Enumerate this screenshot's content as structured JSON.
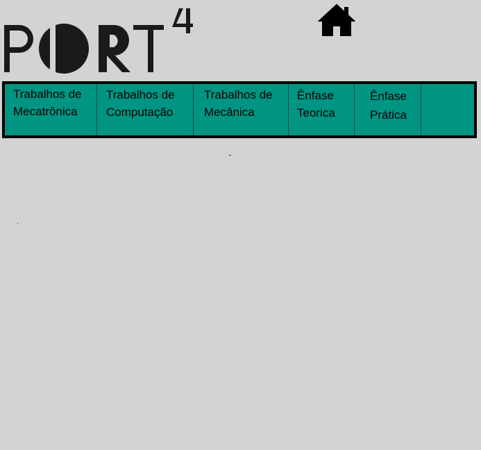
{
  "header": {
    "logo_text": "PORT",
    "logo_superscript": "4",
    "home_icon": "home-icon"
  },
  "nav": {
    "items": [
      {
        "line1": "Trabalhos de",
        "line2": "Mecatrônica"
      },
      {
        "line1": "Trabalhos de",
        "line2": "Computação"
      },
      {
        "line1": "Trabalhos de",
        "line2": "Mecânica"
      },
      {
        "line1": "Ênfase",
        "line2": "Teorica"
      },
      {
        "line1": "Ênfase",
        "line2": "Prática"
      },
      {
        "line1": "",
        "line2": ""
      }
    ]
  },
  "colors": {
    "background": "#d3d3d3",
    "nav_background": "#009483",
    "nav_border": "#000000",
    "logo": "#1a1a1a"
  }
}
